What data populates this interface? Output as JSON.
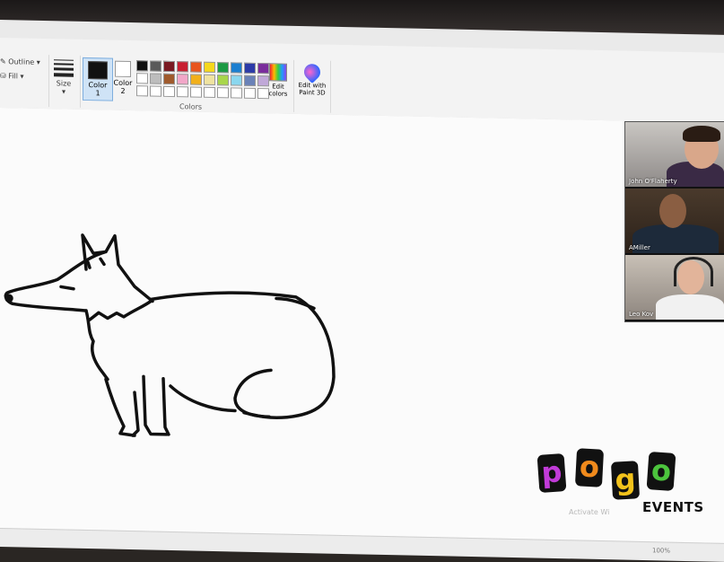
{
  "ribbon": {
    "outline_label": "Outline",
    "fill_label": "Fill",
    "size_label": "Size",
    "color1_label": "Color",
    "color1_num": "1",
    "color2_label": "Color",
    "color2_num": "2",
    "palette": [
      "#111111",
      "#5a5a5a",
      "#7a1a22",
      "#c82032",
      "#e8551e",
      "#f5d81c",
      "#1c9a44",
      "#1b7fd0",
      "#2c3ba8",
      "#7a2d9c",
      "#ffffff",
      "#bdbdbd",
      "#a05a2c",
      "#f2a6c8",
      "#f2b01b",
      "#efe3a0",
      "#a8d64a",
      "#8ad7ef",
      "#6a82b8",
      "#c0a8d8",
      "#ffffff",
      "#ffffff",
      "#ffffff",
      "#ffffff",
      "#ffffff",
      "#ffffff",
      "#ffffff",
      "#ffffff",
      "#ffffff",
      "#ffffff"
    ],
    "colors_label": "Colors",
    "edit_colors_line1": "Edit",
    "edit_colors_line2": "colors",
    "paint3d_line1": "Edit with",
    "paint3d_line2": "Paint 3D"
  },
  "video_call": {
    "participants": [
      {
        "name": "John O'Flaherty"
      },
      {
        "name": "AMiller"
      },
      {
        "name": "Leo Kov"
      }
    ]
  },
  "logo": {
    "letters": [
      "p",
      "o",
      "g",
      "o"
    ],
    "subtitle": "EVENTS"
  },
  "status": {
    "activate_text": "Activate Wi",
    "zoom": "100%"
  },
  "icons": {
    "outline": "pencil-icon",
    "fill": "fill-bucket-icon",
    "edit_colors": "rainbow-icon",
    "paint3d": "paint3d-icon"
  },
  "colors": {
    "stroke": "#111111",
    "ribbon_bg": "#f3f3f3",
    "canvas_bg": "#fbfbfb",
    "selected_highlight": "#cfe3f6"
  }
}
